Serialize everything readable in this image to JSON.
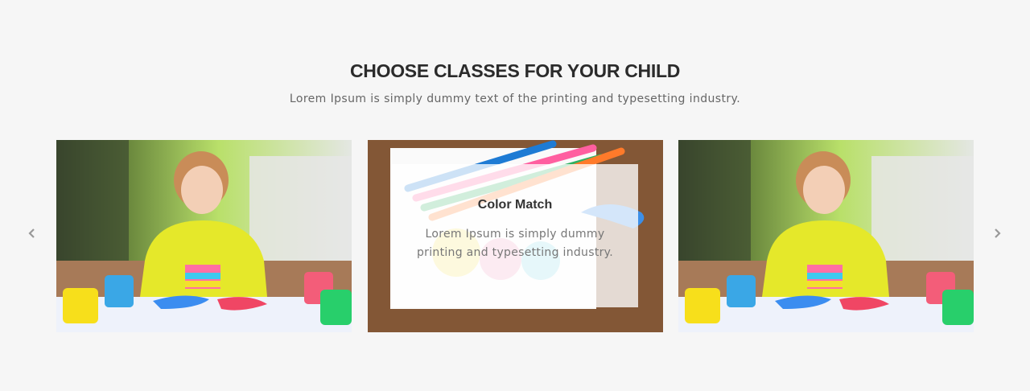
{
  "section": {
    "title": "CHOOSE CLASSES FOR YOUR CHILD",
    "subtitle": "Lorem Ipsum is simply dummy text of the printing and typesetting industry."
  },
  "carousel": {
    "prev_icon": "chevron-left-icon",
    "next_icon": "chevron-right-icon",
    "cards": [
      {
        "image": "girl-painting-photo",
        "title": "",
        "text": ""
      },
      {
        "image": "pencils-notebook-photo",
        "title": "Color Match",
        "text": "Lorem Ipsum is simply dummy printing and typesetting industry."
      },
      {
        "image": "girl-painting-photo",
        "title": "",
        "text": ""
      }
    ]
  },
  "colors": {
    "background": "#f6f6f6",
    "heading": "#2b2b2b",
    "body_text": "#666666",
    "arrow": "#999999"
  }
}
